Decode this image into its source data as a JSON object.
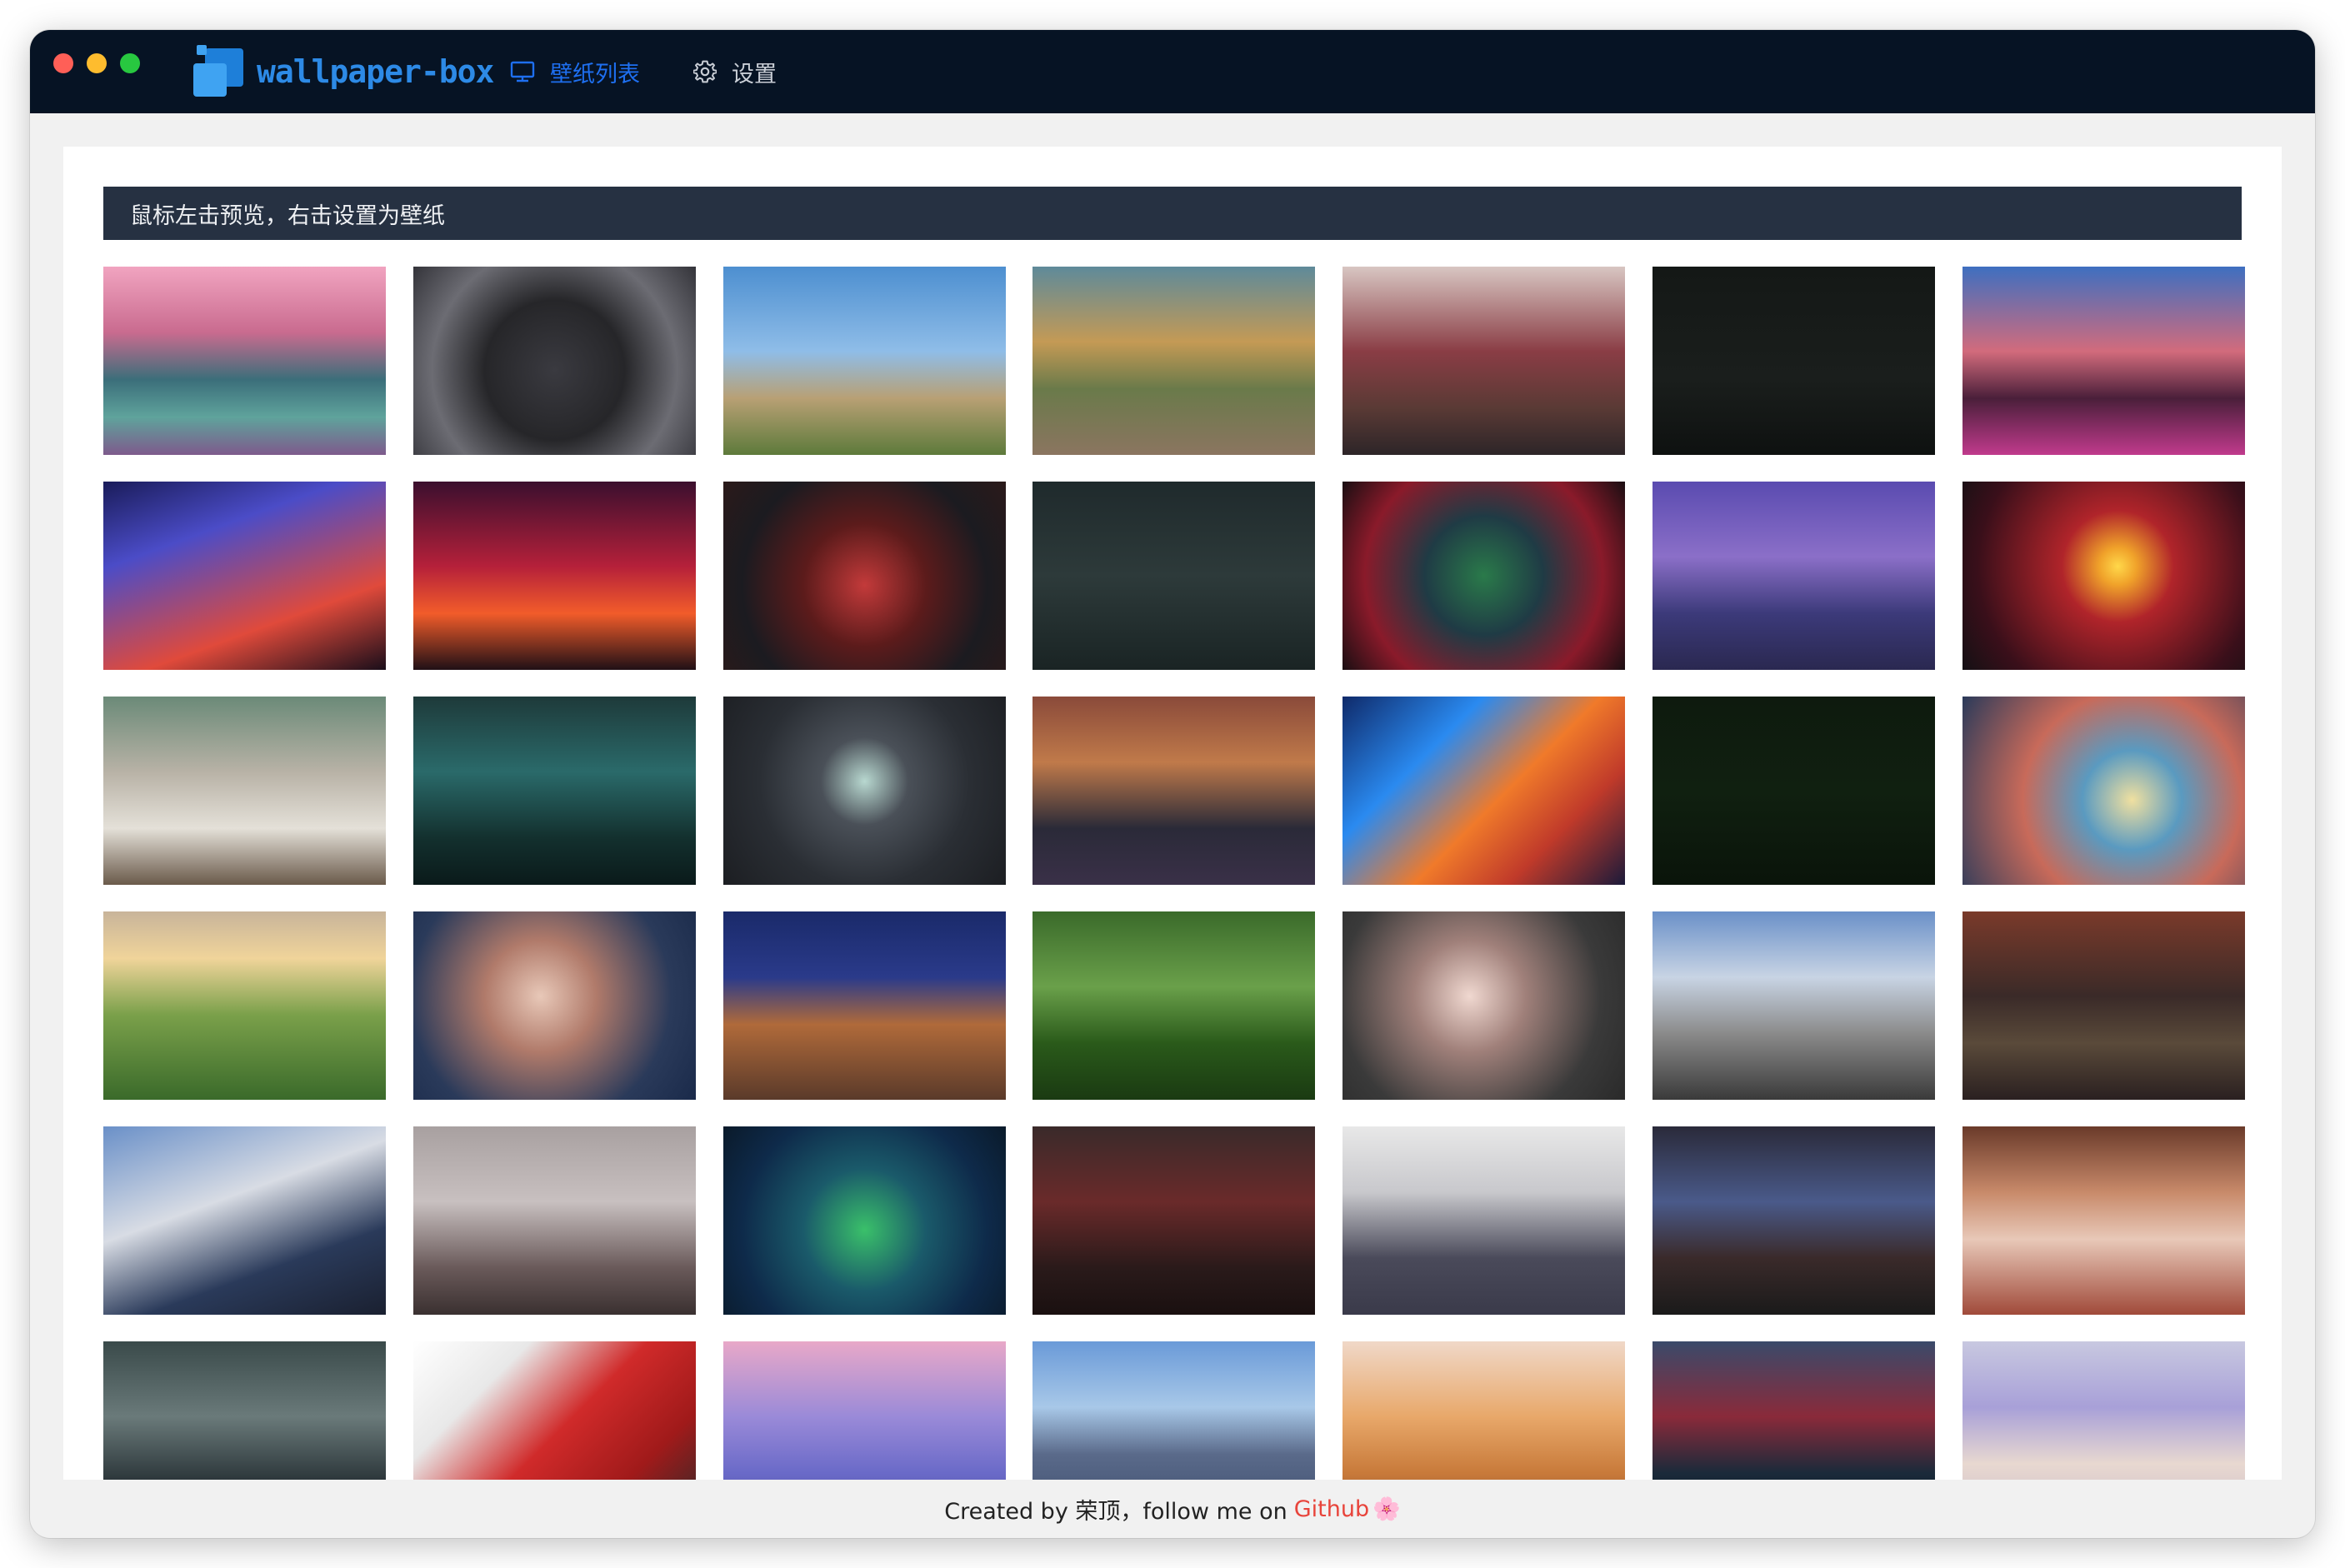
{
  "app": {
    "name": "wallpaper-box"
  },
  "nav": [
    {
      "label": "壁纸列表",
      "icon": "monitor-icon",
      "active": true
    },
    {
      "label": "设置",
      "icon": "gear-icon",
      "active": false
    }
  ],
  "hint": "鼠标左击预览，右击设置为壁纸",
  "footer": {
    "prefix": "Created by 荣顶，follow me on",
    "link": "Github",
    "emoji": "🌸"
  },
  "colors": {
    "titlebar": "#061324",
    "accent": "#1e6ff0",
    "hint_bg": "#263142",
    "link": "#e8443b"
  },
  "thumbnails": [
    "linear-gradient(180deg,#f1a4c0 0%,#c96b8f 35%,#3b6e7a 60%,#5fa39c 80%,#7e5a8c 100%)",
    "radial-gradient(circle at 50% 55%,#3a3a40 0%,#262629 40%,#6c6c73 70%,#34343a 100%)",
    "linear-gradient(180deg,#4d8fd0 0%,#8fbde8 45%,#b8a074 70%,#5d7a3b 100%)",
    "linear-gradient(180deg,#5e8a9a 0%,#c49a55 40%,#6a7a4a 65%,#8b7560 100%)",
    "linear-gradient(180deg,#d8c6c2 0%,#8a3d45 45%,#5a3a35 75%,#2d2528 100%)",
    "linear-gradient(180deg,#141816 0%,#1a1e1c 60%,#0e1110 100%)",
    "linear-gradient(180deg,#3e6fc0 0%,#d26b7c 45%,#4a1f3a 70%,#c03a8c 100%)",
    "linear-gradient(160deg,#1a1c5a 0%,#4b4cc7 30%,#e04a3b 70%,#1a0e1a 100%)",
    "linear-gradient(180deg,#3b0f2e 0%,#b5203a 45%,#f25c2a 70%,#201016 100%)",
    "radial-gradient(circle at 50% 55%,#c33a3a 0%,#5c1b1b 35%,#1b1b20 70%,#2b1a1a 100%)",
    "linear-gradient(180deg,#1f2a2c 0%,#2d3a3a 50%,#1a2424 100%)",
    "radial-gradient(circle at 50% 50%,#2a7a4a 0%,#1f3b45 35%,#8a1a2a 70%,#1a0e12 100%)",
    "linear-gradient(180deg,#5a4bb0 0%,#8b6fc8 40%,#3c3a7a 70%,#2a2850 100%)",
    "radial-gradient(circle at 55% 45%,#ffd84a 0%,#f0a22a 10%,#b0242a 30%,#3a0f1a 75%,#141014 100%)",
    "linear-gradient(180deg,#6b8a78 0%,#b8b2a6 40%,#e4e0d8 70%,#6a5a4a 100%)",
    "linear-gradient(180deg,#1e3a3a 0%,#2a6a6a 40%,#13302e 75%,#0a1a1a 100%)",
    "radial-gradient(circle at 50% 45%,#b8d8d0 0%,#4a5058 25%,#2a2e34 60%,#1c1e22 100%)",
    "linear-gradient(180deg,#8a4a3a 0%,#c07a4a 35%,#2a2a38 70%,#3a3048 100%)",
    "linear-gradient(135deg,#0f2a6a 0%,#2a8af0 30%,#f07a2a 55%,#c03a2a 75%,#1a1a3a 100%)",
    "linear-gradient(180deg,#0e1a0e 0%,#102010 50%,#0a140a 100%)",
    "radial-gradient(circle at 60% 55%,#f0e0a0 0%,#5a9ac0 25%,#c86a5a 55%,#2a3a5a 100%)",
    "linear-gradient(180deg,#c8b49a 0%,#f0d49a 25%,#7aa04a 55%,#3a6a2a 100%)",
    "radial-gradient(circle at 45% 45%,#e8c8b8 0%,#b07a6a 30%,#2a3a5a 70%,#1a2a4a 100%)",
    "linear-gradient(180deg,#1a2a6a 0%,#2a3a8a 35%,#b06a3a 60%,#5a3a2a 100%)",
    "linear-gradient(180deg,#3a6a2a 0%,#6aa04a 40%,#2a5a1a 70%,#1a3a12 100%)",
    "radial-gradient(circle at 45% 45%,#f0d8d0 0%,#a0807a 30%,#3a3a3a 70%,#2a2a2a 100%)",
    "linear-gradient(180deg,#6a90c8 0%,#c8d4e4 35%,#8a8a8a 65%,#3a3a3a 100%)",
    "linear-gradient(180deg,#7a3a2a 0%,#3a2a28 45%,#5a4a3a 70%,#2a2020 100%)",
    "linear-gradient(160deg,#6a90c8 0%,#d8dce4 40%,#2a3a5a 70%,#1a2030 100%)",
    "linear-gradient(180deg,#a8a0a0 0%,#c8c0c0 40%,#6a5a5a 75%,#3a3030 100%)",
    "radial-gradient(circle at 50% 55%,#3ac06a 0%,#1a5a6a 35%,#0e2a4a 70%,#0a1a2a 100%)",
    "linear-gradient(180deg,#3a2a2a 0%,#6a2a2a 40%,#2a1a1a 75%,#1a1010 100%)",
    "linear-gradient(180deg,#e8e8e8 0%,#c8c8cc 35%,#4a4a5a 70%,#3a3a4a 100%)",
    "linear-gradient(180deg,#2a2a3a 0%,#4a5a8a 40%,#3a2a2a 70%,#1a1a1a 100%)",
    "linear-gradient(180deg,#6a3a2a 0%,#c88a6a 35%,#e8c8b8 60%,#a04a3a 100%)",
    "linear-gradient(180deg,#3a4a4a 0%,#6a7a7a 40%,#2a3438 75%,#1a2024 100%)",
    "linear-gradient(135deg,#ffffff 0%,#e8e8e8 25%,#d02a2a 50%,#a01a1a 75%,#2a2a2a 100%)",
    "linear-gradient(180deg,#e8a8c8 0%,#9a8ad8 40%,#6a6ac8 70%,#4a4a9a 100%)",
    "linear-gradient(180deg,#6a9ad8 0%,#a8c8e8 35%,#5a6a8a 60%,#3a4a6a 100%)",
    "linear-gradient(180deg,#f0d8c8 0%,#e8a86a 40%,#c87a3a 70%,#8a4a2a 100%)",
    "linear-gradient(180deg,#3a4a6a 0%,#8a2a3a 40%,#1a2a3a 70%,#0a1420 100%)",
    "linear-gradient(180deg,#c8c8e0 0%,#a8a0d8 35%,#e8d8d0 65%,#c8b8c8 100%)"
  ]
}
